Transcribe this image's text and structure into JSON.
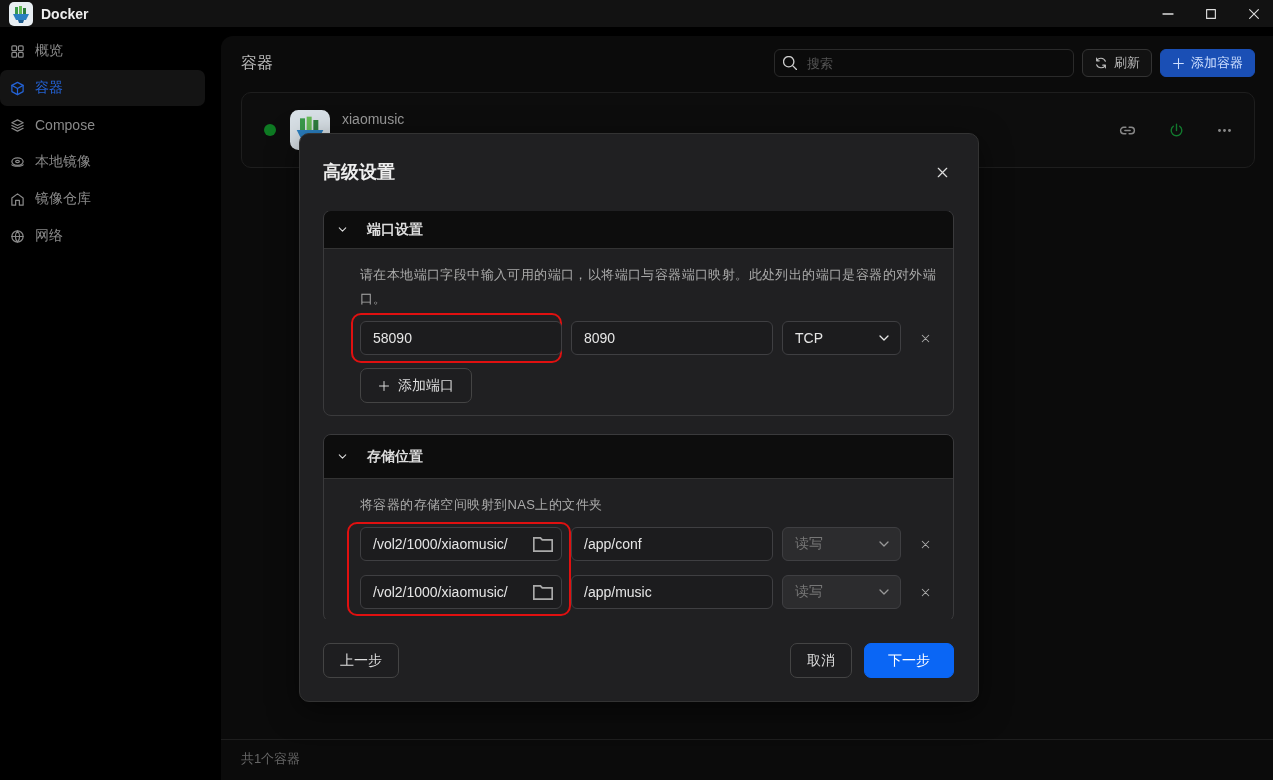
{
  "window": {
    "title": "Docker"
  },
  "sidebar": {
    "items": [
      {
        "label": "概览",
        "selected": false
      },
      {
        "label": "容器",
        "selected": true
      },
      {
        "label": "Compose",
        "selected": false
      },
      {
        "label": "本地镜像",
        "selected": false
      },
      {
        "label": "镜像仓库",
        "selected": false
      },
      {
        "label": "网络",
        "selected": false
      }
    ]
  },
  "main": {
    "title": "容器",
    "search": {
      "placeholder": "搜索"
    },
    "buttons": [
      {
        "label": "刷新",
        "kind": "secondary"
      },
      {
        "label": "添加容器",
        "kind": "primary"
      }
    ],
    "containers": [
      {
        "name": "xiaomusic",
        "running": true
      }
    ],
    "footer": "共1个容器"
  },
  "dialog": {
    "title": "高级设置",
    "sections": [
      {
        "title": "端口设置",
        "expanded": true,
        "description": "请在本地端口字段中输入可用的端口，以将端口与容器端口映射。此处列出的端口是容器的对外端口。",
        "highlight_first_column": true,
        "rows": [
          {
            "fields": [
              {
                "kind": "text",
                "value": "58090"
              },
              {
                "kind": "text",
                "value": "8090"
              }
            ],
            "select": {
              "value": "TCP",
              "disabled": false
            }
          }
        ],
        "add_button": "添加端口"
      },
      {
        "title": "存储位置",
        "expanded": true,
        "description": "将容器的存储空间映射到NAS上的文件夹",
        "highlight_first_column": true,
        "rows": [
          {
            "fields": [
              {
                "kind": "folder",
                "value": "/vol2/1000/xiaomusic/"
              },
              {
                "kind": "text",
                "value": "/app/conf"
              }
            ],
            "select": {
              "value": "读写",
              "disabled": true
            }
          },
          {
            "fields": [
              {
                "kind": "folder",
                "value": "/vol2/1000/xiaomusic/"
              },
              {
                "kind": "text",
                "value": "/app/music"
              }
            ],
            "select": {
              "value": "读写",
              "disabled": true
            }
          }
        ]
      }
    ],
    "buttons": [
      {
        "label": "上一步",
        "kind": "secondary"
      },
      {
        "label": "取消",
        "kind": "secondary"
      },
      {
        "label": "下一步",
        "kind": "primary"
      }
    ]
  }
}
